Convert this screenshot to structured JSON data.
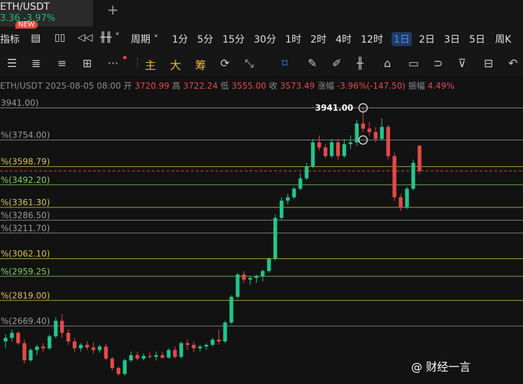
{
  "tab": {
    "title": "ETH/USDT",
    "price_line": "3.36  -3.97%"
  },
  "toolbar": {
    "indicators_label": "指标",
    "new_badge": "NEW",
    "period_label": "周期",
    "intervals": [
      "1分",
      "5分",
      "15分",
      "30分",
      "1时",
      "2时",
      "4时",
      "12时",
      "1日",
      "2日",
      "3日",
      "5日",
      "周K"
    ],
    "active_interval": "1日",
    "tools_gold": [
      "主",
      "大",
      "筹"
    ]
  },
  "info": {
    "symbol": "ETH/USDT",
    "datetime": "2025-08-05 08:00",
    "open_label": "开",
    "open": "3720.99",
    "high_label": "高",
    "high": "3722.24",
    "low_label": "低",
    "low": "3555.00",
    "close_label": "收",
    "close": "3573.49",
    "change_label": "涨幅",
    "change": "-3.96%(-147.50)",
    "amp_label": "振幅",
    "amplitude": "4.49%"
  },
  "chart_data": {
    "type": "candlestick",
    "colors": {
      "up": "#22c58b",
      "down": "#e34a4a"
    },
    "fib_levels": [
      {
        "label": "3941.00)",
        "value": 3941.0,
        "color": "#9a9a9a"
      },
      {
        "label": "%(3754.00)",
        "value": 3754.0,
        "color": "#9a9a9a"
      },
      {
        "label": "%(3598.79)",
        "value": 3598.79,
        "color": "#d8c24a"
      },
      {
        "label": "%(3492.20)",
        "value": 3492.2,
        "color": "#7fcf5a"
      },
      {
        "label": "%(3361.30)",
        "value": 3361.3,
        "color": "#d8c24a"
      },
      {
        "label": "%(3286.50)",
        "value": 3286.5,
        "color": "#9a9a9a"
      },
      {
        "label": "%(3211.70)",
        "value": 3211.7,
        "color": "#9a9a9a"
      },
      {
        "label": "%(3062.10)",
        "value": 3062.1,
        "color": "#d8c24a"
      },
      {
        "label": "%(2959.25)",
        "value": 2959.25,
        "color": "#7fcf5a"
      },
      {
        "label": "%(2819.00)",
        "value": 2819.0,
        "color": "#d8c24a"
      },
      {
        "label": "%(2669.40)",
        "value": 2669.4,
        "color": "#9a9a9a"
      }
    ],
    "current_price": 3573.49,
    "peak_annotation": {
      "label": "3941.00",
      "value": 3941.0
    },
    "candles": [
      [
        2580,
        2620,
        2540,
        2600
      ],
      [
        2600,
        2650,
        2580,
        2630
      ],
      [
        2630,
        2640,
        2560,
        2570
      ],
      [
        2570,
        2590,
        2450,
        2470
      ],
      [
        2470,
        2540,
        2460,
        2530
      ],
      [
        2530,
        2560,
        2500,
        2550
      ],
      [
        2550,
        2570,
        2520,
        2540
      ],
      [
        2540,
        2620,
        2530,
        2610
      ],
      [
        2610,
        2720,
        2600,
        2700
      ],
      [
        2700,
        2740,
        2600,
        2630
      ],
      [
        2630,
        2650,
        2560,
        2580
      ],
      [
        2580,
        2600,
        2520,
        2540
      ],
      [
        2540,
        2570,
        2520,
        2560
      ],
      [
        2560,
        2580,
        2530,
        2545
      ],
      [
        2545,
        2575,
        2510,
        2530
      ],
      [
        2530,
        2560,
        2515,
        2550
      ],
      [
        2550,
        2565,
        2470,
        2480
      ],
      [
        2480,
        2490,
        2410,
        2425
      ],
      [
        2425,
        2435,
        2380,
        2390
      ],
      [
        2390,
        2480,
        2380,
        2470
      ],
      [
        2470,
        2520,
        2460,
        2500
      ],
      [
        2500,
        2520,
        2470,
        2480
      ],
      [
        2480,
        2510,
        2470,
        2495
      ],
      [
        2495,
        2515,
        2480,
        2490
      ],
      [
        2490,
        2520,
        2470,
        2500
      ],
      [
        2500,
        2520,
        2480,
        2485
      ],
      [
        2485,
        2540,
        2480,
        2530
      ],
      [
        2530,
        2550,
        2480,
        2490
      ],
      [
        2490,
        2580,
        2480,
        2570
      ],
      [
        2570,
        2590,
        2530,
        2560
      ],
      [
        2560,
        2580,
        2520,
        2540
      ],
      [
        2540,
        2560,
        2520,
        2550
      ],
      [
        2550,
        2570,
        2530,
        2560
      ],
      [
        2560,
        2600,
        2550,
        2590
      ],
      [
        2590,
        2650,
        2560,
        2580
      ],
      [
        2580,
        2700,
        2570,
        2690
      ],
      [
        2690,
        2850,
        2680,
        2840
      ],
      [
        2840,
        2980,
        2830,
        2970
      ],
      [
        2970,
        2990,
        2920,
        2940
      ],
      [
        2940,
        2960,
        2910,
        2950
      ],
      [
        2950,
        2970,
        2920,
        2960
      ],
      [
        2960,
        3000,
        2930,
        2990
      ],
      [
        2990,
        3070,
        2980,
        3060
      ],
      [
        3060,
        3320,
        3050,
        3300
      ],
      [
        3300,
        3420,
        3290,
        3400
      ],
      [
        3400,
        3440,
        3380,
        3420
      ],
      [
        3420,
        3480,
        3410,
        3470
      ],
      [
        3470,
        3560,
        3460,
        3530
      ],
      [
        3530,
        3620,
        3520,
        3600
      ],
      [
        3600,
        3760,
        3590,
        3740
      ],
      [
        3740,
        3780,
        3690,
        3710
      ],
      [
        3710,
        3730,
        3650,
        3660
      ],
      [
        3660,
        3760,
        3650,
        3740
      ],
      [
        3740,
        3760,
        3640,
        3660
      ],
      [
        3660,
        3760,
        3650,
        3730
      ],
      [
        3730,
        3780,
        3700,
        3740
      ],
      [
        3740,
        3870,
        3720,
        3850
      ],
      [
        3850,
        3941,
        3800,
        3820
      ],
      [
        3820,
        3860,
        3780,
        3800
      ],
      [
        3800,
        3830,
        3740,
        3760
      ],
      [
        3760,
        3880,
        3750,
        3830
      ],
      [
        3830,
        3840,
        3640,
        3660
      ],
      [
        3660,
        3680,
        3400,
        3420
      ],
      [
        3420,
        3440,
        3340,
        3360
      ],
      [
        3360,
        3480,
        3350,
        3470
      ],
      [
        3470,
        3640,
        3460,
        3620
      ],
      [
        3720.99,
        3722.24,
        3555.0,
        3573.49
      ]
    ],
    "ylim": [
      2340,
      4000
    ]
  },
  "watermark": "@ 财经一言"
}
